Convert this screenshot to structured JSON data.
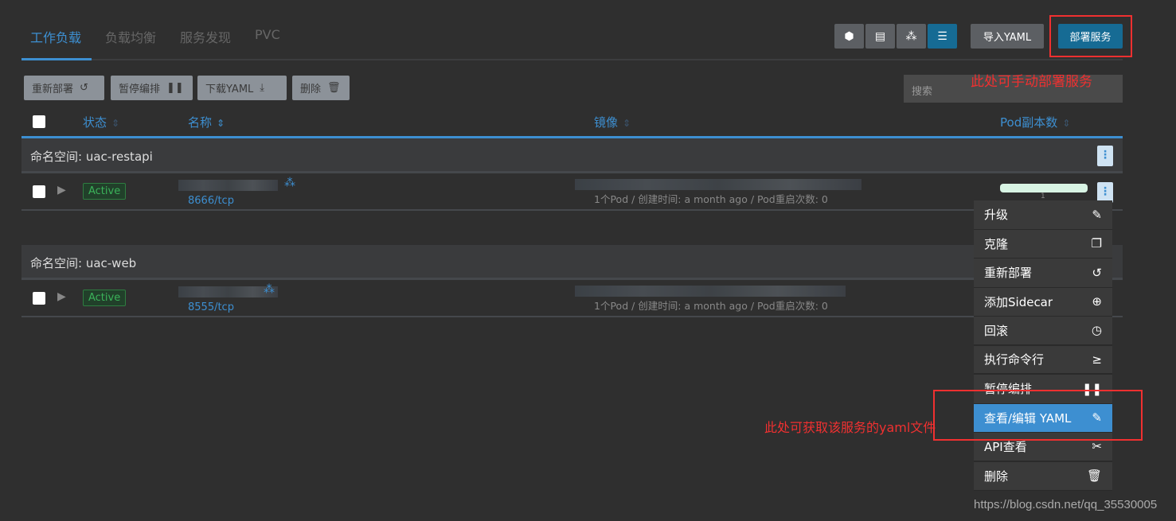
{
  "tabs": [
    {
      "label": "工作负载",
      "active": true
    },
    {
      "label": "负载均衡"
    },
    {
      "label": "服务发现"
    },
    {
      "label": "PVC"
    }
  ],
  "view_buttons": [
    "cube-icon",
    "list-icon",
    "cluster-icon",
    "tree-list-icon"
  ],
  "import_yaml": "导入YAML",
  "deploy_service": "部署服务",
  "toolbar": {
    "redeploy": "重新部署",
    "pause": "暂停编排",
    "download": "下载YAML",
    "delete": "删除"
  },
  "search": {
    "placeholder": "搜索"
  },
  "columns": {
    "state": "状态",
    "name": "名称",
    "image": "镜像",
    "replicas": "Pod副本数"
  },
  "groups": [
    {
      "namespace": "命名空间: uac-restapi",
      "row": {
        "status": "Active",
        "port": "8666/tcp",
        "meta": "1个Pod / 创建时间: a month ago / Pod重启次数: 0",
        "replicas": "1"
      }
    },
    {
      "namespace": "命名空间: uac-web",
      "row": {
        "status": "Active",
        "port": "8555/tcp",
        "meta": "1个Pod / 创建时间: a month ago / Pod重启次数: 0"
      }
    }
  ],
  "menu": [
    {
      "label": "升级",
      "icon": "pencil-icon"
    },
    {
      "label": "克隆",
      "icon": "copy-icon"
    },
    {
      "label": "重新部署",
      "icon": "redo-icon"
    },
    {
      "label": "添加Sidecar",
      "icon": "plus-circle-icon"
    },
    {
      "label": "回滚",
      "icon": "history-icon"
    },
    {
      "label": "执行命令行",
      "icon": "terminal-icon"
    },
    {
      "label": "暂停编排",
      "icon": "pause-icon"
    },
    {
      "label": "查看/编辑 YAML",
      "icon": "pencil-icon",
      "highlighted": true
    },
    {
      "label": "API查看",
      "icon": "api-icon"
    },
    {
      "label": "删除",
      "icon": "trash-icon"
    }
  ],
  "annotations": {
    "deploy": "此处可手动部署服务",
    "yaml": "此处可获取该服务的yaml文件"
  },
  "watermark": "https://blog.csdn.net/qq_35530005",
  "colors": {
    "accent": "#3d8fd1",
    "primary_button": "#166b94",
    "annotation": "#f03030",
    "active": "#3bb35a"
  }
}
